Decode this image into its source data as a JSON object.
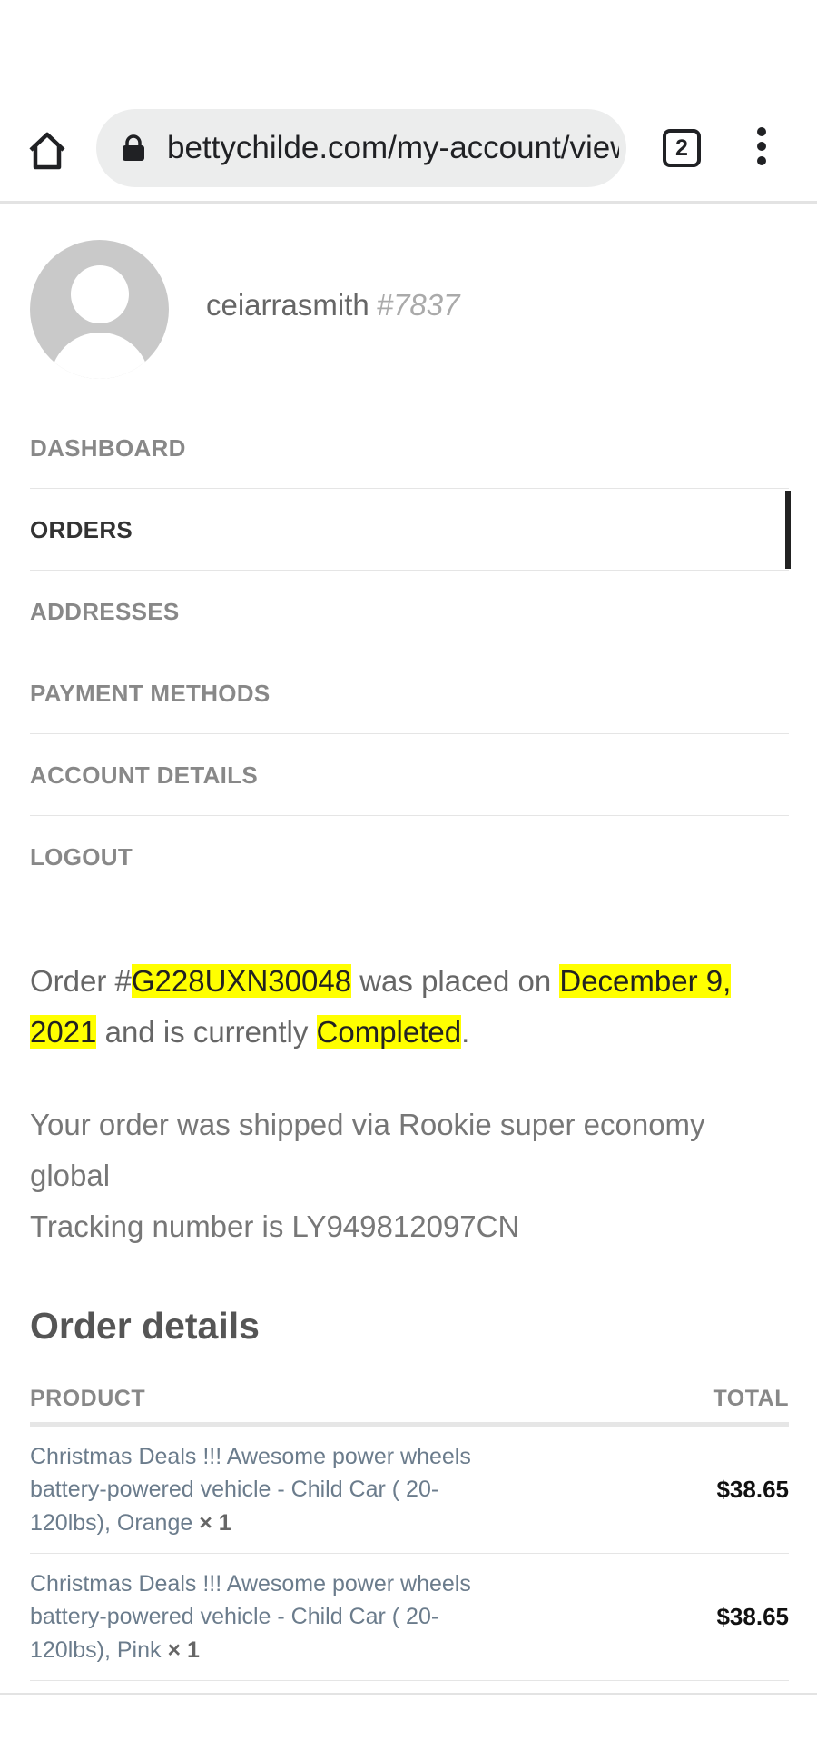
{
  "browser": {
    "url": "bettychilde.com/my-account/view-order",
    "tab_count": "2",
    "icons": {
      "home": "home-icon",
      "lock": "lock-icon",
      "menu": "more-vert-icon"
    }
  },
  "profile": {
    "username": "ceiarrasmith",
    "user_id": "#7837"
  },
  "nav": {
    "items": [
      {
        "label": "DASHBOARD"
      },
      {
        "label": "ORDERS"
      },
      {
        "label": "ADDRESSES"
      },
      {
        "label": "PAYMENT METHODS"
      },
      {
        "label": "ACCOUNT DETAILS"
      },
      {
        "label": "LOGOUT"
      }
    ],
    "active": "ORDERS"
  },
  "order": {
    "prefix": "Order #",
    "number": "G228UXN30048",
    "placed_text": " was placed on ",
    "date": "December 9, 2021",
    "and_text": " and is currently ",
    "status": "Completed",
    "end": ".",
    "shipping_line1": "Your order was shipped via Rookie super economy global",
    "shipping_line2": "Tracking number is LY949812097CN"
  },
  "details": {
    "title": "Order details",
    "col_product": "PRODUCT",
    "col_total": "TOTAL",
    "rows": [
      {
        "product": "Christmas Deals !!! Awesome power wheels battery-powered vehicle - Child Car ( 20-120lbs), Orange",
        "qty": "× 1",
        "total": "$38.65"
      },
      {
        "product": "Christmas Deals !!! Awesome power wheels battery-powered vehicle - Child Car ( 20-120lbs), Pink",
        "qty": "× 1",
        "total": "$38.65"
      }
    ]
  },
  "colors": {
    "highlight": "#ffff00",
    "nav_active_bar": "#222222"
  }
}
